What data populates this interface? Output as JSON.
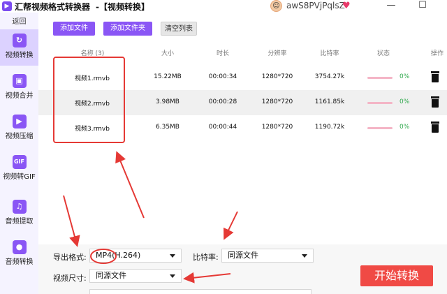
{
  "titlebar": {
    "app_title": "汇帮视频格式转换器",
    "section": "-【视频转换】",
    "user_name": "awS8PVjPqlsZ",
    "logo_glyph": "▶",
    "avatar_glyph": "☺"
  },
  "sidebar": {
    "back": "返回",
    "items": [
      {
        "label": "视频转换",
        "icon": "video-convert-icon",
        "glyph": "↻"
      },
      {
        "label": "视频合并",
        "icon": "video-merge-icon",
        "glyph": "▣"
      },
      {
        "label": "视频压缩",
        "icon": "video-compress-icon",
        "glyph": "▶"
      },
      {
        "label": "视频转GIF",
        "icon": "gif-icon",
        "glyph": "GIF"
      },
      {
        "label": "音频提取",
        "icon": "music-icon",
        "glyph": "♫"
      },
      {
        "label": "音频转换",
        "icon": "mic-icon",
        "glyph": "●"
      }
    ]
  },
  "toolbar": {
    "add_file": "添加文件",
    "add_folder": "添加文件夹",
    "clear_list": "清空列表"
  },
  "table": {
    "headers": {
      "name": "名称 (3)",
      "size": "大小",
      "duration": "时长",
      "resolution": "分辨率",
      "bitrate": "比特率",
      "status": "状态",
      "action": "操作"
    },
    "rows": [
      {
        "name": "视频1.rmvb",
        "size": "15.22MB",
        "duration": "00:00:34",
        "resolution": "1280*720",
        "bitrate": "3754.27k",
        "progress": "0%"
      },
      {
        "name": "视频2.rmvb",
        "size": "3.98MB",
        "duration": "00:00:28",
        "resolution": "1280*720",
        "bitrate": "1161.85k",
        "progress": "0%"
      },
      {
        "name": "视频3.rmvb",
        "size": "6.35MB",
        "duration": "00:00:44",
        "resolution": "1280*720",
        "bitrate": "1190.72k",
        "progress": "0%"
      }
    ]
  },
  "settings": {
    "format_label": "导出格式:",
    "format_value": "MP4(H.264)",
    "bitrate_label": "比特率:",
    "bitrate_value": "同源文件",
    "size_label": "视频尺寸:",
    "size_value": "同源文件"
  },
  "start_button": "开始转换",
  "colors": {
    "accent": "#8a56f5",
    "start": "#f04a45",
    "annotation": "#e53935",
    "progress_text": "#2ea84b"
  }
}
